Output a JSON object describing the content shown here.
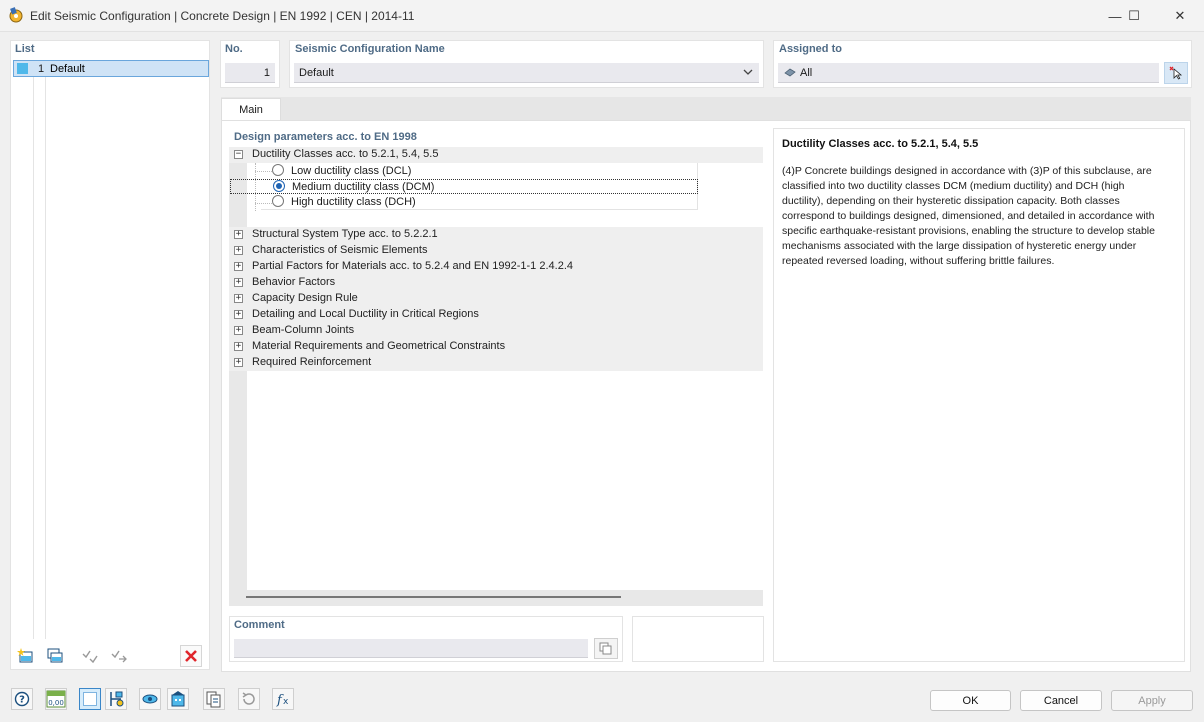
{
  "window": {
    "title": "Edit Seismic Configuration | Concrete Design | EN 1992 | CEN | 2014-11",
    "minimize_glyph": "—",
    "maximize_glyph": "☐",
    "close_glyph": "✕"
  },
  "list": {
    "header": "List",
    "items": [
      {
        "number": "1",
        "name": "Default"
      }
    ]
  },
  "no_field": {
    "label": "No.",
    "value": "1"
  },
  "name_field": {
    "label": "Seismic Configuration Name",
    "value": "Default"
  },
  "assigned": {
    "label": "Assigned to",
    "value": "All"
  },
  "tabs": [
    {
      "label": "Main"
    }
  ],
  "design_params": {
    "header": "Design parameters acc. to EN 1998",
    "groups": [
      {
        "label": "Ductility Classes acc. to 5.2.1, 5.4, 5.5",
        "expanded": true,
        "symbol": "−"
      },
      {
        "label": "Structural System Type acc. to 5.2.2.1",
        "symbol": "+"
      },
      {
        "label": "Characteristics of Seismic Elements",
        "symbol": "+"
      },
      {
        "label": "Partial Factors for Materials acc. to 5.2.4 and EN 1992-1-1 2.4.2.4",
        "symbol": "+"
      },
      {
        "label": "Behavior Factors",
        "symbol": "+"
      },
      {
        "label": "Capacity Design Rule",
        "symbol": "+"
      },
      {
        "label": "Detailing and Local Ductility in Critical Regions",
        "symbol": "+"
      },
      {
        "label": "Beam-Column Joints",
        "symbol": "+"
      },
      {
        "label": "Material Requirements and Geometrical Constraints",
        "symbol": "+"
      },
      {
        "label": "Required Reinforcement",
        "symbol": "+"
      }
    ],
    "ductility_options": [
      {
        "label": "Low ductility class (DCL)",
        "selected": false
      },
      {
        "label": "Medium ductility class (DCM)",
        "selected": true
      },
      {
        "label": "High ductility class (DCH)",
        "selected": false
      }
    ]
  },
  "description": {
    "title": "Ductility Classes acc. to 5.2.1, 5.4, 5.5",
    "body_lines": [
      "(4)P Concrete buildings designed in accordance with (3)P of this subclause, are",
      "classified into two ductility classes DCM (medium ductility) and DCH (high",
      "ductility), depending on their hysteretic dissipation capacity. Both classes",
      "correspond to buildings designed, dimensioned, and detailed in accordance with",
      "specific earthquake-resistant provisions, enabling the structure to develop stable",
      "mechanisms associated with the large dissipation of hysteretic energy under",
      "repeated reversed loading, without suffering brittle failures."
    ]
  },
  "comment": {
    "label": "Comment",
    "value": ""
  },
  "buttons": {
    "ok": "OK",
    "cancel": "Cancel",
    "apply": "Apply"
  },
  "units_icon_text": "0,00",
  "colors": {
    "accent": "#1f64b4",
    "selection": "#cfe3f6",
    "header_text": "#4f6b86",
    "delete_red": "#e0252b"
  }
}
